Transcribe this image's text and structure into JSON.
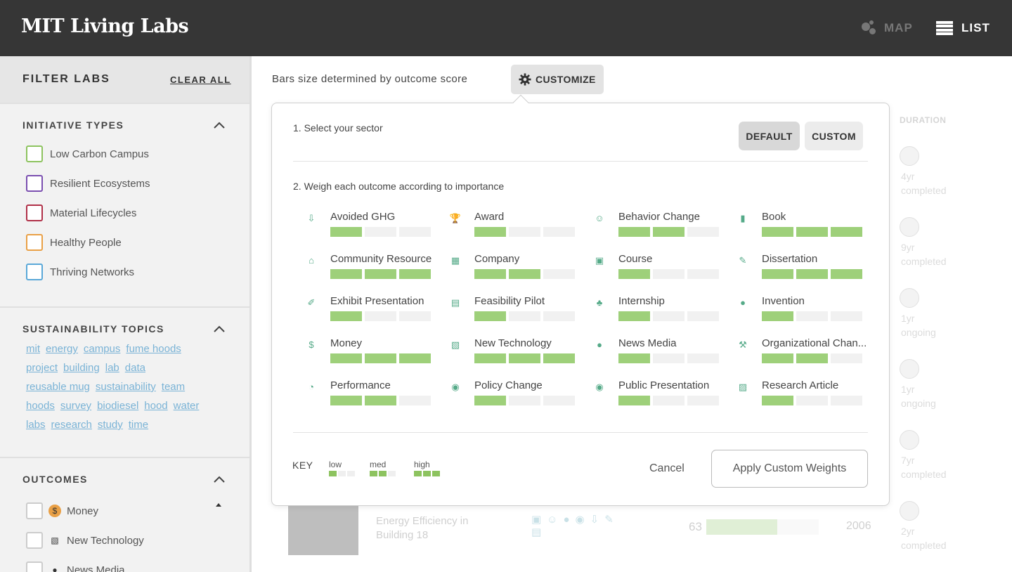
{
  "header": {
    "brand": "MIT Living Labs",
    "nav_map": "MAP",
    "nav_list": "LIST"
  },
  "sidebar": {
    "title": "FILTER LABS",
    "clear_all": "CLEAR ALL",
    "initiative_types": {
      "title": "INITIATIVE TYPES",
      "items": [
        {
          "label": "Low Carbon Campus",
          "color": "#8dc35f"
        },
        {
          "label": "Resilient Ecosystems",
          "color": "#7b4fb0"
        },
        {
          "label": "Material Lifecycles",
          "color": "#b03048"
        },
        {
          "label": "Healthy People",
          "color": "#e9a046"
        },
        {
          "label": "Thriving Networks",
          "color": "#5aa8d8"
        }
      ]
    },
    "sustainability_topics": {
      "title": "SUSTAINABILITY TOPICS",
      "tags": [
        "mit",
        "energy",
        "campus",
        "fume hoods",
        "project",
        "building",
        "lab",
        "data",
        "reusable mug",
        "sustainability",
        "team",
        "hoods",
        "survey",
        "biodiesel",
        "hood",
        "water",
        "labs",
        "research",
        "study",
        "time"
      ]
    },
    "outcomes": {
      "title": "OUTCOMES",
      "items": [
        {
          "label": "Money",
          "icon": "money-icon"
        },
        {
          "label": "New Technology",
          "icon": "new-technology-icon"
        },
        {
          "label": "News Media",
          "icon": "news-media-icon"
        }
      ]
    }
  },
  "main": {
    "bars_label": "Bars size determined by outcome score",
    "customize_label": "CUSTOMIZE",
    "bg": {
      "duration_header": "DURATION",
      "durations": [
        {
          "value": "4yr",
          "status": "completed"
        },
        {
          "value": "9yr",
          "status": "completed"
        },
        {
          "value": "1yr",
          "status": "ongoing"
        },
        {
          "value": "1yr",
          "status": "ongoing"
        },
        {
          "value": "7yr",
          "status": "completed"
        },
        {
          "value": "2yr",
          "status": "completed"
        }
      ],
      "row_title": "Energy Efficiency in Building 18",
      "row_score": "63",
      "row_score_fraction": 0.63,
      "row_year": "2006"
    }
  },
  "popup": {
    "step1": "1. Select your sector",
    "default_label": "DEFAULT",
    "custom_label": "CUSTOM",
    "step2": "2. Weigh each outcome according to importance",
    "outcomes": [
      {
        "label": "Avoided GHG",
        "level": 1,
        "icon": "avoided-ghg-icon",
        "glyph": "⇩"
      },
      {
        "label": "Award",
        "level": 1,
        "icon": "trophy-icon",
        "glyph": "🏆"
      },
      {
        "label": "Behavior Change",
        "level": 2,
        "icon": "smiley-icon",
        "glyph": "☺"
      },
      {
        "label": "Book",
        "level": 3,
        "icon": "book-icon",
        "glyph": "▮"
      },
      {
        "label": "Community Resource",
        "level": 3,
        "icon": "community-icon",
        "glyph": "⌂"
      },
      {
        "label": "Company",
        "level": 2,
        "icon": "building-icon",
        "glyph": "▦"
      },
      {
        "label": "Course",
        "level": 1,
        "icon": "course-icon",
        "glyph": "▣"
      },
      {
        "label": "Dissertation",
        "level": 3,
        "icon": "pencil-icon",
        "glyph": "✎"
      },
      {
        "label": "Exhibit Presentation",
        "level": 1,
        "icon": "exhibit-icon",
        "glyph": "✐"
      },
      {
        "label": "Feasibility Pilot",
        "level": 1,
        "icon": "clipboard-icon",
        "glyph": "▤"
      },
      {
        "label": "Internship",
        "level": 1,
        "icon": "plant-icon",
        "glyph": "♣"
      },
      {
        "label": "Invention",
        "level": 1,
        "icon": "lightbulb-icon",
        "glyph": "●"
      },
      {
        "label": "Money",
        "level": 3,
        "icon": "money-icon",
        "glyph": "$"
      },
      {
        "label": "New Technology",
        "level": 3,
        "icon": "new-technology-icon",
        "glyph": "▧"
      },
      {
        "label": "News Media",
        "level": 1,
        "icon": "microphone-icon",
        "glyph": "●"
      },
      {
        "label": "Organizational Chan...",
        "level": 2,
        "icon": "wrench-icon",
        "glyph": "⚒"
      },
      {
        "label": "Performance",
        "level": 2,
        "icon": "gauge-icon",
        "glyph": "◔"
      },
      {
        "label": "Policy Change",
        "level": 1,
        "icon": "compass-icon",
        "glyph": "◉"
      },
      {
        "label": "Public Presentation",
        "level": 1,
        "icon": "eye-icon",
        "glyph": "◉"
      },
      {
        "label": "Research Article",
        "level": 1,
        "icon": "research-article-icon",
        "glyph": "▨"
      }
    ],
    "key_label": "KEY",
    "key_items": [
      {
        "label": "low",
        "level": 1
      },
      {
        "label": "med",
        "level": 2
      },
      {
        "label": "high",
        "level": 3
      }
    ],
    "cancel_label": "Cancel",
    "apply_label": "Apply Custom Weights"
  },
  "colors": {
    "topbar": "#363636",
    "bar_on": "#9ed07a",
    "bar_off": "#f1f1f1",
    "tag_link": "#7ab3d6"
  }
}
